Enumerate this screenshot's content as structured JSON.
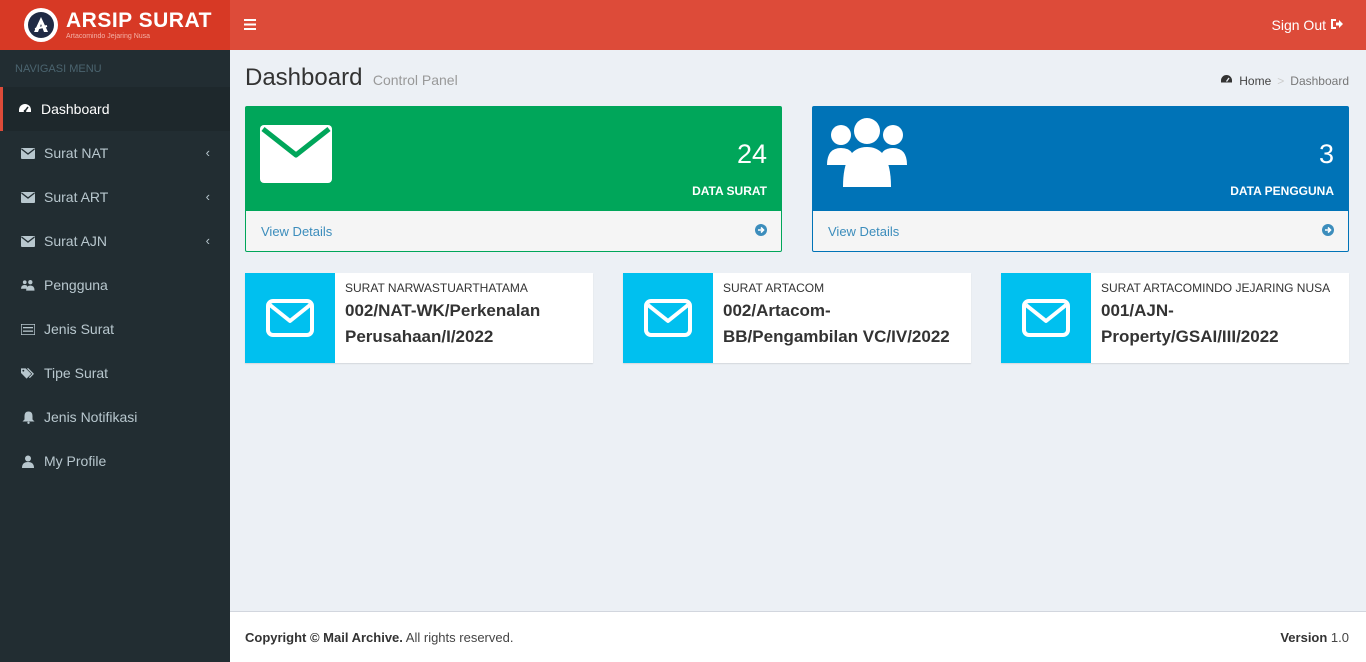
{
  "logo": {
    "title": "ARSIP SURAT",
    "subtitle": "Artacomindo Jejaring Nusa"
  },
  "navbar": {
    "signout_label": "Sign Out"
  },
  "sidebar": {
    "header": "NAVIGASI MENU",
    "items": [
      {
        "label": "Dashboard",
        "icon": "dashboard-icon",
        "active": true
      },
      {
        "label": "Surat NAT",
        "icon": "envelope-icon",
        "has_submenu": true
      },
      {
        "label": "Surat ART",
        "icon": "envelope-icon",
        "has_submenu": true
      },
      {
        "label": "Surat AJN",
        "icon": "envelope-icon",
        "has_submenu": true
      },
      {
        "label": "Pengguna",
        "icon": "users-icon"
      },
      {
        "label": "Jenis Surat",
        "icon": "list-icon"
      },
      {
        "label": "Tipe Surat",
        "icon": "tags-icon"
      },
      {
        "label": "Jenis Notifikasi",
        "icon": "bell-icon"
      },
      {
        "label": "My Profile",
        "icon": "user-icon"
      }
    ]
  },
  "header": {
    "title": "Dashboard",
    "subtitle": "Control Panel",
    "breadcrumb": {
      "home": "Home",
      "current": "Dashboard"
    }
  },
  "stats": [
    {
      "count": "24",
      "label": "DATA SURAT",
      "link": "View Details",
      "color": "#00a65a"
    },
    {
      "count": "3",
      "label": "DATA PENGGUNA",
      "link": "View Details",
      "color": "#0073b7"
    }
  ],
  "latest": [
    {
      "title": "SURAT NARWASTUARTHATAMA",
      "line1": "002/NAT-WK/Perkenalan",
      "line2": "Perusahaan/I/2022"
    },
    {
      "title": "SURAT ARTACOM",
      "line1": "002/Artacom-",
      "line2": "BB/Pengambilan VC/IV/2022"
    },
    {
      "title": "SURAT ARTACOMINDO JEJARING NUSA",
      "line1": "001/AJN-",
      "line2": "Property/GSAI/III/2022"
    }
  ],
  "footer": {
    "copyright_bold": "Copyright © Mail Archive.",
    "copyright_rest": " All rights reserved.",
    "version_label": "Version",
    "version_value": " 1.0"
  },
  "colors": {
    "header": "#dd4b39",
    "logo_bg": "#d73925",
    "sidebar": "#222d32",
    "info_icon": "#00c0ef"
  }
}
